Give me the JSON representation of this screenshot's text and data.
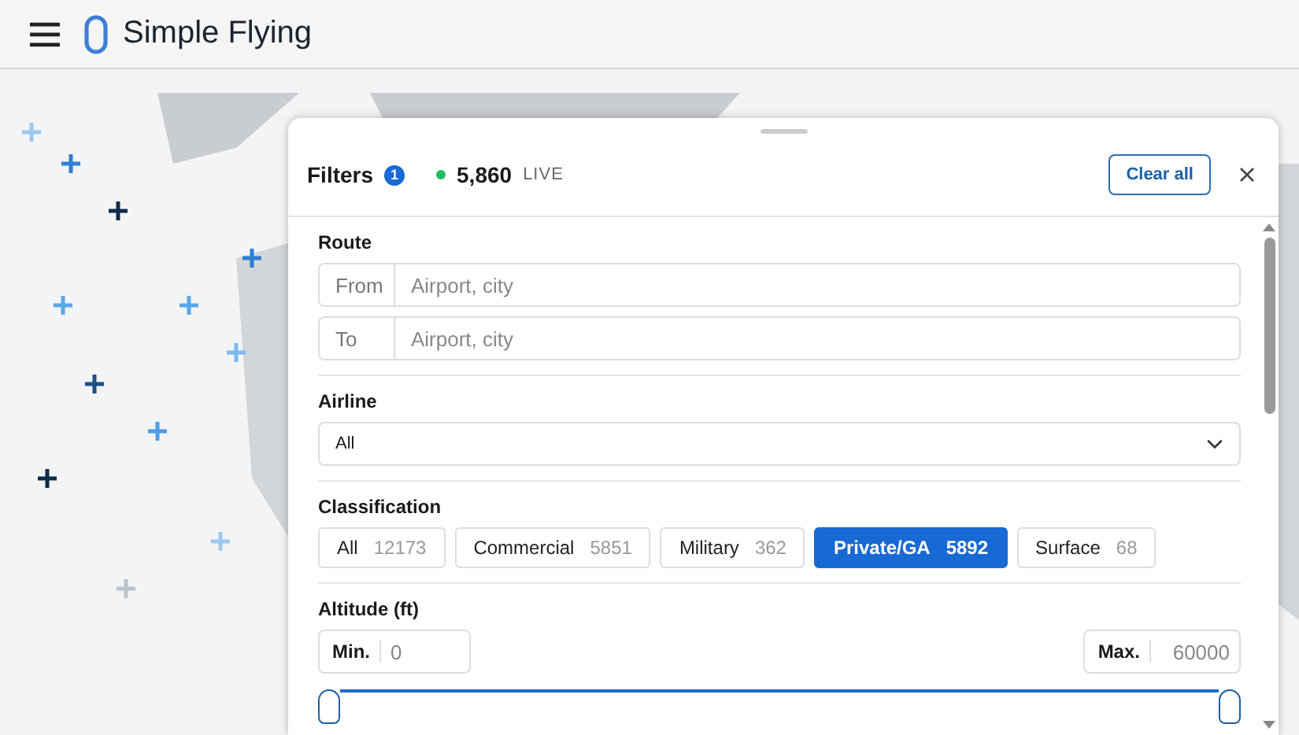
{
  "header": {
    "title": "Simple Flying"
  },
  "filters": {
    "title": "Filters",
    "badge": "1",
    "live_count": "5,860",
    "live_label": "LIVE",
    "clear_button": "Clear all"
  },
  "route": {
    "label": "Route",
    "fields": [
      {
        "prefix": "From",
        "placeholder": "Airport, city"
      },
      {
        "prefix": "To",
        "placeholder": "Airport, city"
      }
    ]
  },
  "airline": {
    "label": "Airline",
    "value": "All"
  },
  "classification": {
    "label": "Classification",
    "options": [
      {
        "label": "All",
        "count": "12173",
        "selected": false
      },
      {
        "label": "Commercial",
        "count": "5851",
        "selected": false
      },
      {
        "label": "Military",
        "count": "362",
        "selected": false
      },
      {
        "label": "Private/GA",
        "count": "5892",
        "selected": true
      },
      {
        "label": "Surface",
        "count": "68",
        "selected": false
      }
    ]
  },
  "altitude": {
    "label": "Altitude (ft)",
    "min": {
      "label": "Min.",
      "placeholder": "0"
    },
    "max": {
      "label": "Max.",
      "placeholder": "60000"
    },
    "thumbs": [
      {
        "level": 0
      },
      {
        "level": 1
      }
    ]
  }
}
